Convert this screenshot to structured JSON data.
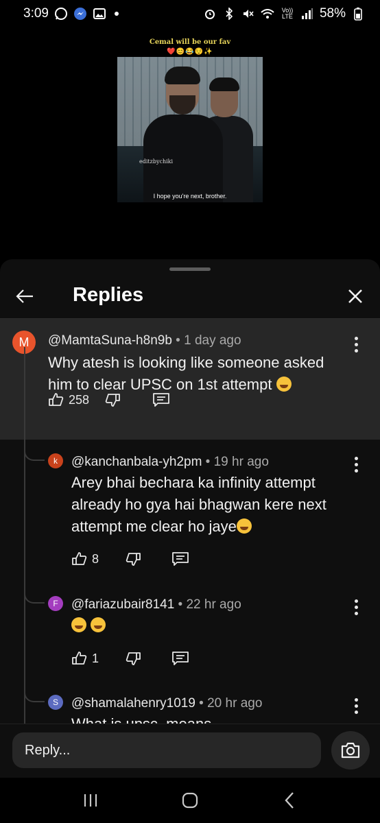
{
  "status_bar": {
    "time": "3:09",
    "lte_label": "Vo)) LTE",
    "battery": "58%",
    "icons": [
      "whatsapp-icon",
      "messenger-icon",
      "gallery-icon",
      "alarm-icon",
      "bluetooth-icon",
      "mute-icon",
      "wifi-icon",
      "signal-icon",
      "battery-icon"
    ]
  },
  "video": {
    "caption_top": "Cemal will be our fav",
    "caption_emojis": "❤️😊😂😌✨",
    "watermark": "editzbychiki",
    "subtitle": "I hope you're next, brother."
  },
  "sheet": {
    "title": "Replies",
    "back_icon": "arrow-left-icon",
    "close_icon": "close-icon"
  },
  "parent_comment": {
    "avatar_letter": "M",
    "avatar_color": "#e8542c",
    "handle": "@MamtaSuna-h8n9b",
    "meta": " • 1 day ago",
    "text": "Why atesh is looking like someone asked him to clear UPSC on 1st attempt",
    "likes": "258"
  },
  "replies": [
    {
      "avatar_letter": "k",
      "avatar_color": "#c9421c",
      "handle": "@kanchanbala-yh2pm",
      "meta": " • 19 hr ago",
      "text": "Arey bhai bechara ka infinity attempt already ho gya hai bhagwan kere next attempt me clear ho jaye",
      "likes": "8"
    },
    {
      "avatar_letter": "F",
      "avatar_color": "#a43dbf",
      "handle": "@fariazubair8141",
      "meta": " • 22 hr ago",
      "text": "",
      "likes": "1"
    },
    {
      "avatar_letter": "S",
      "avatar_color": "#5c6bc0",
      "handle": "@shamalahenry1019",
      "meta": " • 20 hr ago",
      "text": "What is upsc. means"
    }
  ],
  "reply_bar": {
    "placeholder": "Reply...",
    "camera_icon": "camera-icon"
  },
  "nav_bar": {
    "icons": [
      "recents-icon",
      "home-icon",
      "back-icon"
    ]
  }
}
